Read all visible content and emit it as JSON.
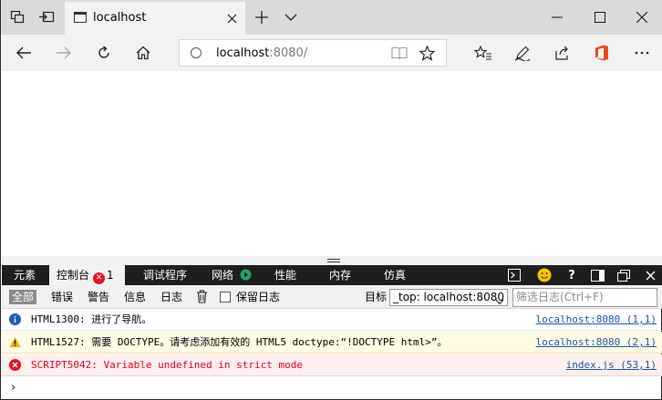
{
  "browser": {
    "tab_title": "localhost",
    "address_host": "localhost",
    "address_rest": ":8080/"
  },
  "devtools": {
    "tabs": [
      {
        "label": "元素"
      },
      {
        "label": "控制台",
        "badge": "1"
      },
      {
        "label": "调试程序"
      },
      {
        "label": "网络"
      },
      {
        "label": "性能"
      },
      {
        "label": "内存"
      },
      {
        "label": "仿真"
      }
    ],
    "active_tab": "控制台"
  },
  "console_toolbar": {
    "filters": [
      "全部",
      "错误",
      "警告",
      "信息",
      "日志"
    ],
    "preserve_log_label": "保留日志",
    "preserve_log_checked": false,
    "target_label": "目标",
    "target_value": "_top: localhost:8080",
    "filter_placeholder": "筛选日志(Ctrl+F)"
  },
  "messages": [
    {
      "type": "info",
      "text": "HTML1300: 进行了导航。",
      "source": "localhost:8080 (1,1)"
    },
    {
      "type": "warning",
      "text": "HTML1527: 需要 DOCTYPE。请考虑添加有效的 HTML5 doctype:“!DOCTYPE html>”。",
      "source": "localhost:8080 (2,1)"
    },
    {
      "type": "error",
      "text": "SCRIPT5042: Variable undefined in strict mode",
      "source": "index.js (53,1)"
    }
  ],
  "prompt_symbol": "›",
  "colors": {
    "info": "#1c5bb8",
    "warning": "#f0b400",
    "error": "#e81123",
    "office": "#e74a1b",
    "devtools_bar": "#1e1e1e"
  }
}
